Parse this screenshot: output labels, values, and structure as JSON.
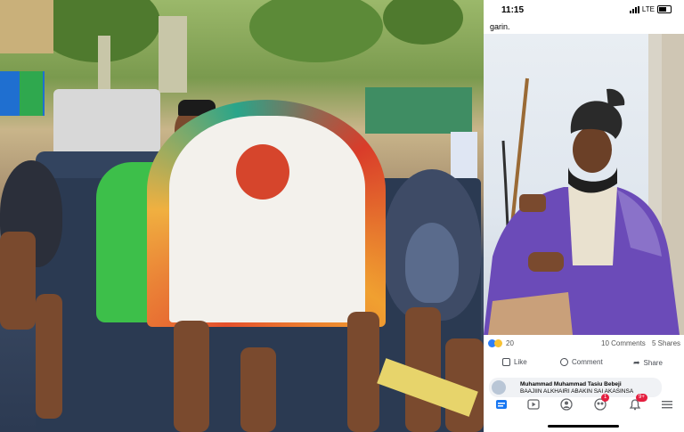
{
  "status_bar": {
    "time": "11:15",
    "network": "LTE"
  },
  "post": {
    "caption_tail": "garin."
  },
  "reactions": {
    "count": "20",
    "comments": "10 Comments",
    "shares": "5 Shares"
  },
  "actions": {
    "like": "Like",
    "comment": "Comment",
    "share": "Share"
  },
  "comment": {
    "author": "Muhammad Muhammad Tasiu Bebeji",
    "text": "BAAJIIN ALKHAIRI ABAKIN SAI AKASINSA"
  },
  "tabbar": {
    "items": [
      "home-icon",
      "watch-icon",
      "profile-icon",
      "groups-icon",
      "notifications-icon",
      "menu-icon"
    ],
    "groups_badge": "1",
    "notifications_badge": "9+"
  },
  "colors": {
    "facebook_blue": "#1877f2",
    "badge_red": "#e41e3f",
    "robe_purple": "#6b4bb8",
    "robe_green": "#3dbf4a"
  }
}
